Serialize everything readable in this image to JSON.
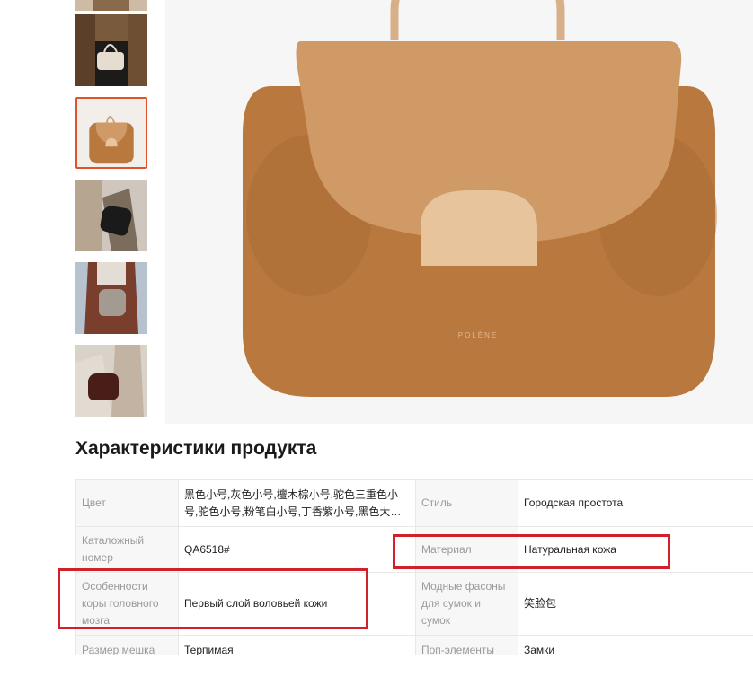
{
  "product": {
    "section_title": "Характеристики продукта",
    "main_image_brand_mark": "POLÈNE",
    "specs": [
      {
        "left_label": "Цвет",
        "left_value": "黑色小号,灰色小号,檀木棕小号,驼色三重色小号,驼色小号,粉笔白小号,丁香紫小号,黑色大号,驼...",
        "right_label": "Стиль",
        "right_value": "Городская простота"
      },
      {
        "left_label": "Каталожный номер",
        "left_value": "QA6518#",
        "right_label": "Материал",
        "right_value": "Натуральная кожа"
      },
      {
        "left_label": "Особенности коры головного мозга",
        "left_value": "Первый слой воловьей кожи",
        "right_label": "Модные фасоны для сумок и сумок",
        "right_value": "笑脸包"
      },
      {
        "left_label": "Размер мешка",
        "left_value": "Терпимая",
        "right_label": "Поп-элементы",
        "right_value": "Замки"
      }
    ]
  },
  "thumbnails": [
    {
      "icon": "bag-photo-icon"
    },
    {
      "icon": "bag-photo-icon"
    },
    {
      "icon": "bag-photo-icon",
      "selected": true
    },
    {
      "icon": "bag-photo-icon"
    },
    {
      "icon": "bag-photo-icon"
    },
    {
      "icon": "bag-photo-icon"
    }
  ],
  "colors": {
    "selected_border": "#e0532a",
    "highlight": "#d0202a",
    "bag": "#b9783e",
    "bag_flap": "#d09a66",
    "bag_tab": "#e7c49c"
  }
}
